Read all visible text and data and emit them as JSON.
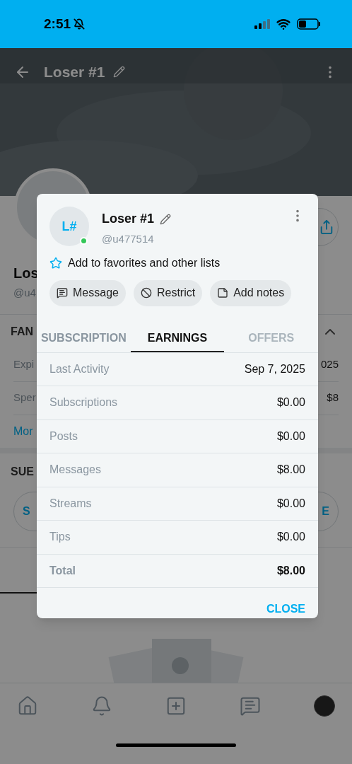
{
  "status_bar": {
    "time": "2:51"
  },
  "header": {
    "title": "Loser #1"
  },
  "profile": {
    "name": "Los",
    "handle": "@u4"
  },
  "fan_section": {
    "heading": "FAN",
    "rows": [
      {
        "label": "Expi",
        "value": "025"
      },
      {
        "label": "Sper",
        "value": "$8"
      }
    ],
    "link": "Mor"
  },
  "subscription_section": {
    "heading": "SUE",
    "buttons": [
      "S",
      "E"
    ]
  },
  "dialog": {
    "avatar_initials": "L#",
    "online": true,
    "name": "Loser #1",
    "handle": "@u477514",
    "favorites": "Add to favorites and other lists",
    "actions": [
      {
        "kind": "message",
        "label": "Message"
      },
      {
        "kind": "restrict",
        "label": "Restrict"
      },
      {
        "kind": "notes",
        "label": "Add notes"
      }
    ],
    "tabs": [
      {
        "label": "SUBSCRIPTION",
        "selected": false,
        "disabled": false
      },
      {
        "label": "EARNINGS",
        "selected": true,
        "disabled": false
      },
      {
        "label": "OFFERS",
        "selected": false,
        "disabled": true
      }
    ],
    "rows": [
      {
        "kind": "row",
        "label": "Last Activity",
        "value": "Sep 7, 2025"
      },
      {
        "kind": "row",
        "label": "Subscriptions",
        "value": "$0.00"
      },
      {
        "kind": "row",
        "label": "Posts",
        "value": "$0.00"
      },
      {
        "kind": "row",
        "label": "Messages",
        "value": "$8.00"
      },
      {
        "kind": "row",
        "label": "Streams",
        "value": "$0.00"
      },
      {
        "kind": "row",
        "label": "Tips",
        "value": "$0.00"
      },
      {
        "kind": "total",
        "label": "Total",
        "value": "$8.00"
      }
    ],
    "close": "CLOSE"
  },
  "bottom_nav": [
    {
      "kind": "home"
    },
    {
      "kind": "bell"
    },
    {
      "kind": "add"
    },
    {
      "kind": "chat"
    },
    {
      "kind": "avatar"
    }
  ]
}
